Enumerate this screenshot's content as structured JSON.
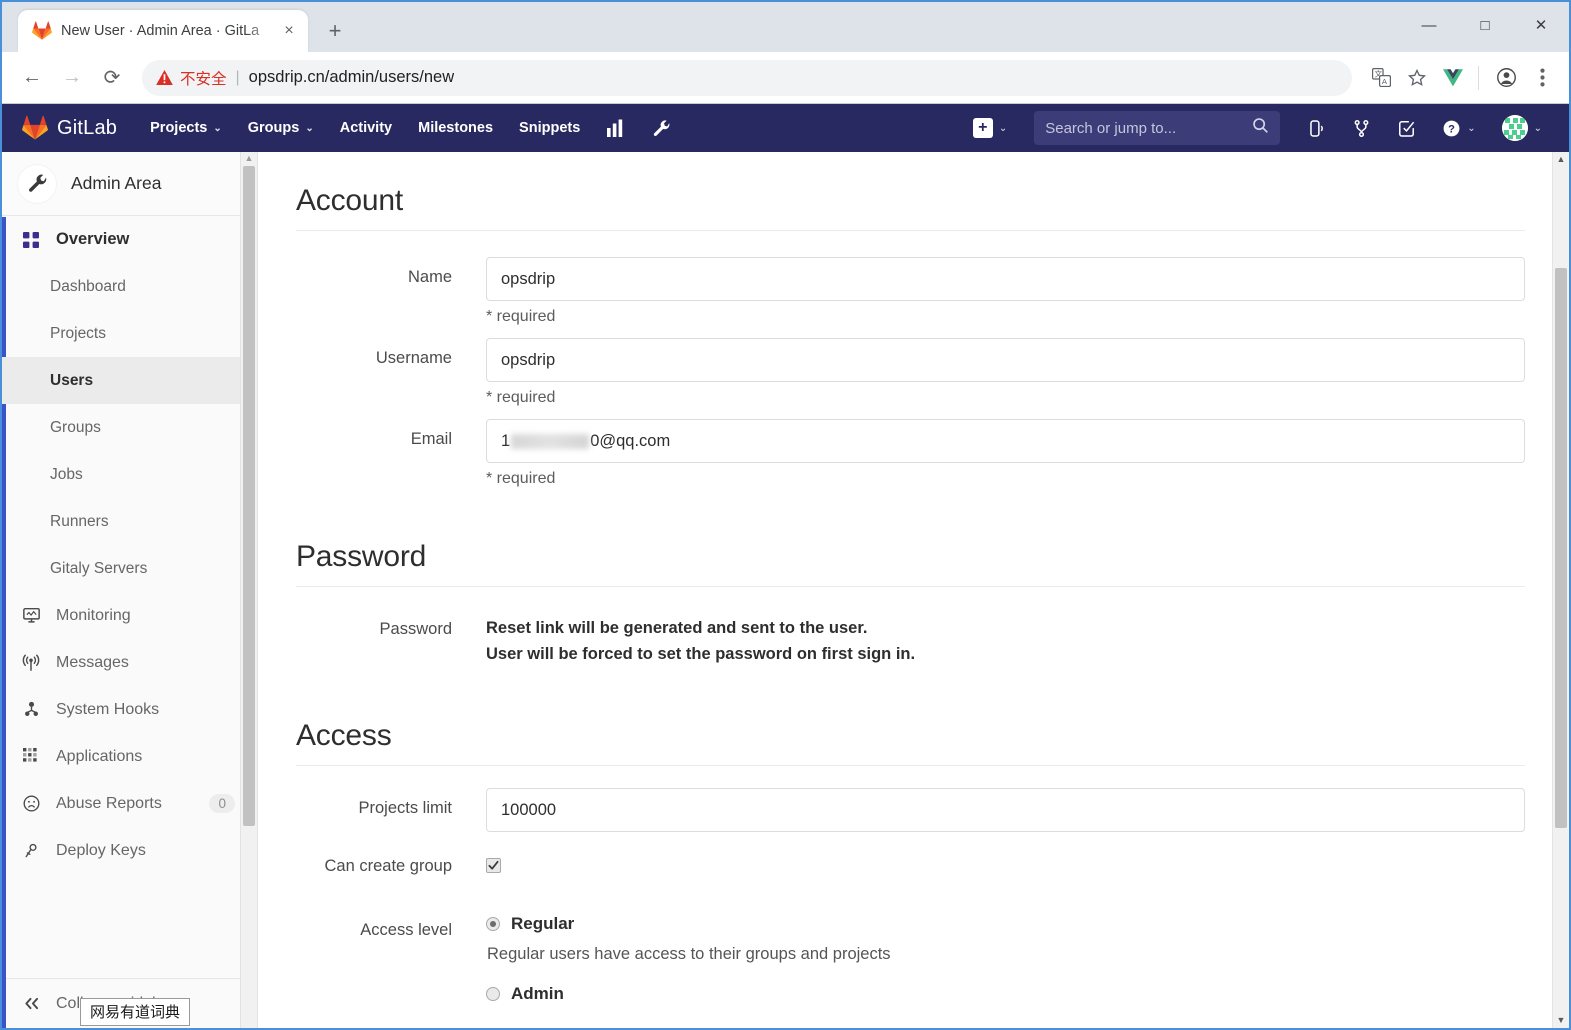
{
  "browser": {
    "tab": {
      "title": "New User · Admin Area · GitLa",
      "favicon": "gitlab-fox-icon",
      "close": "×"
    },
    "new_tab": "+",
    "window_controls": {
      "minimize": "—",
      "maximize": "□",
      "close": "✕"
    },
    "nav": {
      "back": "←",
      "forward": "→",
      "reload": "⟳"
    },
    "omnibox": {
      "security_label": "不安全",
      "separator": "|",
      "url": "opsdrip.cn/admin/users/new"
    },
    "toolbar_icons": [
      "translate-icon",
      "bookmark-star-icon",
      "vue-devtools-icon",
      "profile-avatar-icon",
      "chrome-menu-icon"
    ]
  },
  "gitlab_nav": {
    "brand": "GitLab",
    "items": [
      {
        "label": "Projects",
        "has_caret": true
      },
      {
        "label": "Groups",
        "has_caret": true
      },
      {
        "label": "Activity",
        "has_caret": false
      },
      {
        "label": "Milestones",
        "has_caret": false
      },
      {
        "label": "Snippets",
        "has_caret": false
      }
    ],
    "icon_items": [
      "analytics-chart-icon",
      "admin-wrench-icon"
    ],
    "right": {
      "create_new": "+",
      "search_placeholder": "Search or jump to...",
      "icons": [
        "issues-icon",
        "merge-requests-icon",
        "todos-icon"
      ],
      "help": "?",
      "avatar": "user-avatar"
    },
    "caret": "⌄",
    "bg_color": "#292961"
  },
  "sidebar": {
    "header": {
      "title": "Admin Area",
      "icon": "wrench-icon"
    },
    "overview": {
      "label": "Overview",
      "icon": "overview-grid-icon"
    },
    "sub_items": [
      {
        "label": "Dashboard",
        "active": false
      },
      {
        "label": "Projects",
        "active": false
      },
      {
        "label": "Users",
        "active": true
      },
      {
        "label": "Groups",
        "active": false
      },
      {
        "label": "Jobs",
        "active": false
      },
      {
        "label": "Runners",
        "active": false
      },
      {
        "label": "Gitaly Servers",
        "active": false
      }
    ],
    "items": [
      {
        "label": "Monitoring",
        "icon": "monitor-icon",
        "badge": null
      },
      {
        "label": "Messages",
        "icon": "broadcast-icon",
        "badge": null
      },
      {
        "label": "System Hooks",
        "icon": "hook-icon",
        "badge": null
      },
      {
        "label": "Applications",
        "icon": "applications-icon",
        "badge": null
      },
      {
        "label": "Abuse Reports",
        "icon": "abuse-face-icon",
        "badge": "0"
      },
      {
        "label": "Deploy Keys",
        "icon": "key-icon",
        "badge": null
      }
    ],
    "collapse": {
      "label": "Collapse sidebar",
      "icon": "double-chevron-left-icon"
    },
    "accent_color": "#3954c9"
  },
  "form": {
    "account": {
      "heading": "Account",
      "name": {
        "label": "Name",
        "value": "opsdrip",
        "hint": "* required"
      },
      "username": {
        "label": "Username",
        "value": "opsdrip",
        "hint": "* required"
      },
      "email": {
        "label": "Email",
        "value_prefix": "1",
        "value_suffix": "0@qq.com",
        "redacted": true,
        "hint": "* required"
      }
    },
    "password": {
      "heading": "Password",
      "label": "Password",
      "line1": "Reset link will be generated and sent to the user.",
      "line2": "User will be forced to set the password on first sign in."
    },
    "access": {
      "heading": "Access",
      "projects_limit": {
        "label": "Projects limit",
        "value": "100000"
      },
      "can_create_group": {
        "label": "Can create group",
        "checked": true
      },
      "access_level": {
        "label": "Access level",
        "options": [
          {
            "label": "Regular",
            "selected": true,
            "help": "Regular users have access to their groups and projects"
          },
          {
            "label": "Admin",
            "selected": false,
            "help": ""
          }
        ]
      }
    }
  },
  "tooltip": {
    "text": "网易有道词典"
  }
}
